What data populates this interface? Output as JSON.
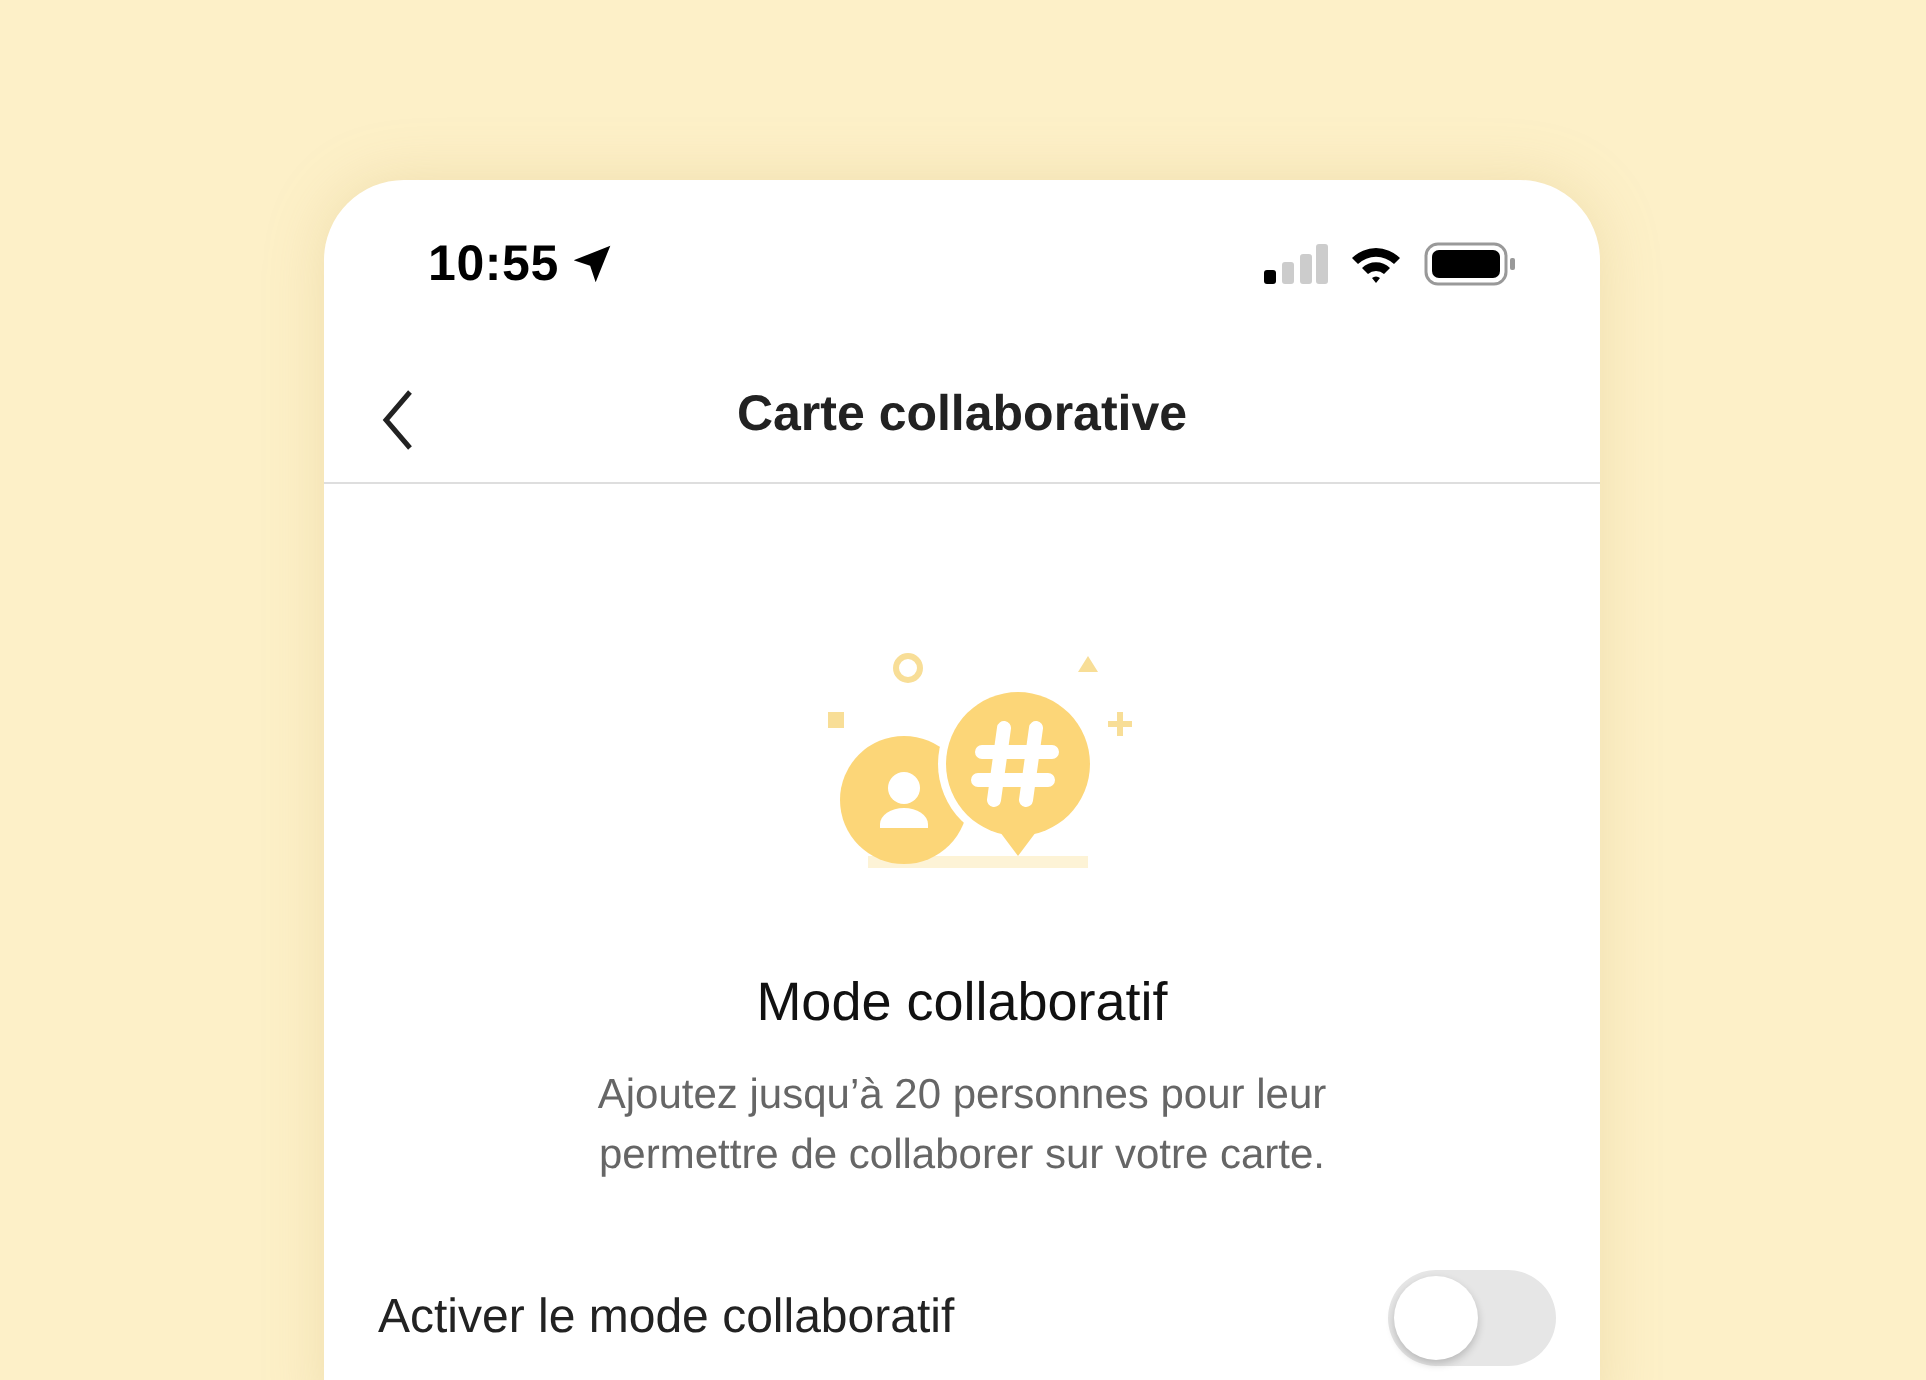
{
  "status_bar": {
    "time": "10:55"
  },
  "nav": {
    "title": "Carte collaborative"
  },
  "intro": {
    "title": "Mode collaboratif",
    "description": "Ajoutez jusqu’à 20 personnes pour leur permettre de collaborer sur votre carte."
  },
  "setting": {
    "label": "Activer le mode collaboratif",
    "on": false
  }
}
